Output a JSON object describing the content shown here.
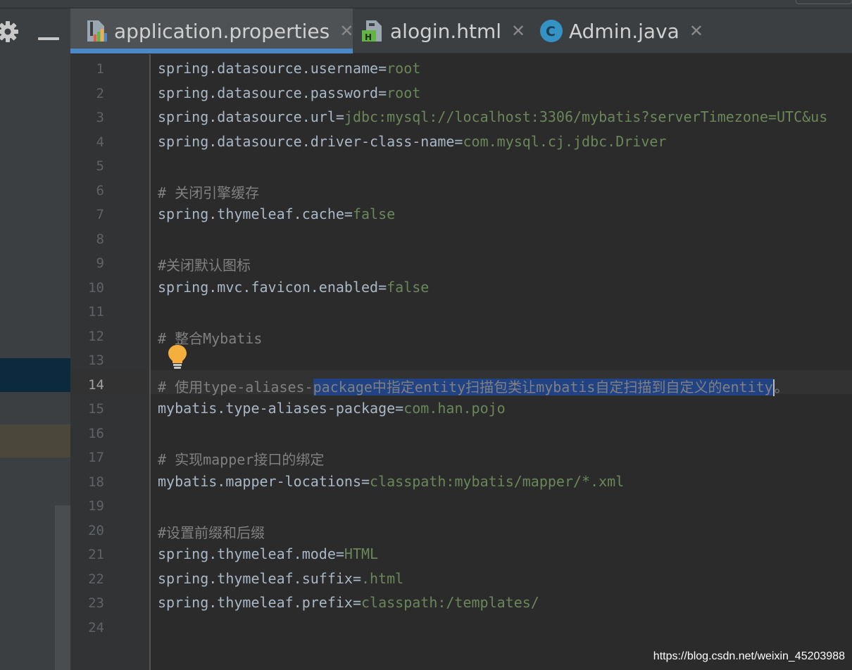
{
  "tabs": [
    {
      "label": "application.properties",
      "icon": "properties-file-icon",
      "active": true
    },
    {
      "label": "alogin.html",
      "icon": "html-file-icon",
      "active": false
    },
    {
      "label": "Admin.java",
      "icon": "java-class-icon",
      "active": false
    }
  ],
  "tab_close_glyph": "✕",
  "left_panel": {
    "settings_icon": "gear-icon",
    "hide_icon": "minus-icon"
  },
  "editor": {
    "current_line": 14,
    "lines": [
      {
        "n": "1",
        "key": "spring.datasource.username=",
        "value": "root"
      },
      {
        "n": "2",
        "key": "spring.datasource.password=",
        "value": "root"
      },
      {
        "n": "3",
        "key": "spring.datasource.url=",
        "value": "jdbc:mysql://localhost:3306/mybatis?serverTimezone=UTC&us"
      },
      {
        "n": "4",
        "key": "spring.datasource.driver-class-name=",
        "value": "com.mysql.cj.jdbc.Driver"
      },
      {
        "n": "5"
      },
      {
        "n": "6",
        "comment": "# 关闭引擎缓存"
      },
      {
        "n": "7",
        "key": "spring.thymeleaf.cache=",
        "value": "false"
      },
      {
        "n": "8"
      },
      {
        "n": "9",
        "comment": "#关闭默认图标"
      },
      {
        "n": "10",
        "key": "spring.mvc.favicon.enabled=",
        "value": "false"
      },
      {
        "n": "11"
      },
      {
        "n": "12",
        "comment": "# 整合Mybatis"
      },
      {
        "n": "13"
      },
      {
        "n": "14",
        "comment_pre": "# 使用type-aliases-",
        "comment_sel": "package中指定entity扫描包类让mybatis自定扫描到自定义的entity",
        "comment_post": "。"
      },
      {
        "n": "15",
        "key": "mybatis.type-aliases-package=",
        "value": "com.han.pojo"
      },
      {
        "n": "16"
      },
      {
        "n": "17",
        "comment": "# 实现mapper接口的绑定"
      },
      {
        "n": "18",
        "key": "mybatis.mapper-locations=",
        "value": "classpath:mybatis/mapper/*.xml"
      },
      {
        "n": "19"
      },
      {
        "n": "20",
        "comment": "#设置前缀和后缀"
      },
      {
        "n": "21",
        "key": "spring.thymeleaf.mode=",
        "value": "HTML"
      },
      {
        "n": "22",
        "key": "spring.thymeleaf.suffix=",
        "value": ".html"
      },
      {
        "n": "23",
        "key": "spring.thymeleaf.prefix=",
        "value": "classpath:/templates/"
      },
      {
        "n": "24"
      }
    ],
    "intention_icon": "lightbulb-icon"
  },
  "watermark": "https://blog.csdn.net/weixin_45203988",
  "colors": {
    "background": "#2b2b2b",
    "gutter": "#313335",
    "key": "#a9b7c6",
    "value": "#6a8759",
    "comment": "#808080",
    "selection": "#214283",
    "tab_underline": "#4a88c7"
  }
}
